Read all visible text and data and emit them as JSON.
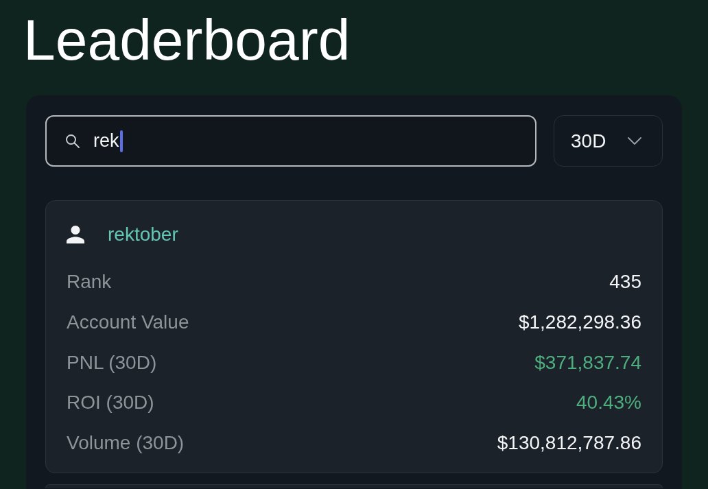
{
  "page": {
    "title": "Leaderboard"
  },
  "search": {
    "value": "rek",
    "focused": true
  },
  "period_select": {
    "value": "30D"
  },
  "results": [
    {
      "username": "rektober",
      "stats": [
        {
          "label": "Rank",
          "value": "435",
          "color": "#f3f4f6"
        },
        {
          "label": "Account Value",
          "value": "$1,282,298.36",
          "color": "#f3f4f6"
        },
        {
          "label": "PNL (30D)",
          "value": "$371,837.74",
          "color": "#4fae7f"
        },
        {
          "label": "ROI (30D)",
          "value": "40.43%",
          "color": "#4fae7f"
        },
        {
          "label": "Volume (30D)",
          "value": "$130,812,787.86",
          "color": "#f3f4f6"
        }
      ]
    }
  ]
}
